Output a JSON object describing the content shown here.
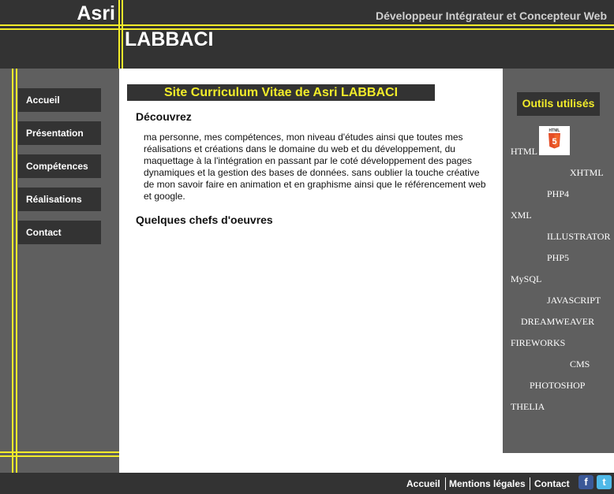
{
  "header": {
    "brand_first": "Asri",
    "brand_last": "LABBACI",
    "tagline": "Développeur Intégrateur et Concepteur Web"
  },
  "nav": {
    "items": [
      {
        "label": "Accueil"
      },
      {
        "label": "Présentation"
      },
      {
        "label": "Compétences"
      },
      {
        "label": "Réalisations"
      },
      {
        "label": "Contact"
      }
    ]
  },
  "main": {
    "title": "Site Curriculum Vitae de Asri LABBACI",
    "section1_heading": "Découvrez",
    "intro": "ma personne, mes compétences, mon niveau d'études ainsi que toutes mes réalisations et créations dans le domaine du web et du développement, du maquettage à la l'intégration en passant par le coté développement des pages dynamiques et la gestion des bases de données. sans oublier la touche créative de mon savoir faire en animation et en graphisme ainsi que le référencement web et google.",
    "section2_heading": "Quelques chefs d'oeuvres"
  },
  "tools": {
    "title": "Outils utilisés",
    "html5_badge": "HTML",
    "html5_number": "5",
    "items": [
      "HTML",
      "XHTML",
      "PHP4",
      "XML",
      "ILLUSTRATOR",
      "PHP5",
      "MySQL",
      "JAVASCRIPT",
      "DREAMWEAVER",
      "FIREWORKS",
      "CMS",
      "PHOTOSHOP",
      "THELIA"
    ]
  },
  "footer": {
    "links": [
      "Accueil",
      "Mentions légales",
      "Contact"
    ],
    "facebook_glyph": "f",
    "twitter_glyph": "t"
  },
  "colors": {
    "dark": "#333333",
    "sidebar": "#5f5f5f",
    "accent_yellow": "#f2ec2a",
    "facebook": "#3b5998",
    "twitter": "#4fb9e8",
    "html5": "#e44d26"
  }
}
